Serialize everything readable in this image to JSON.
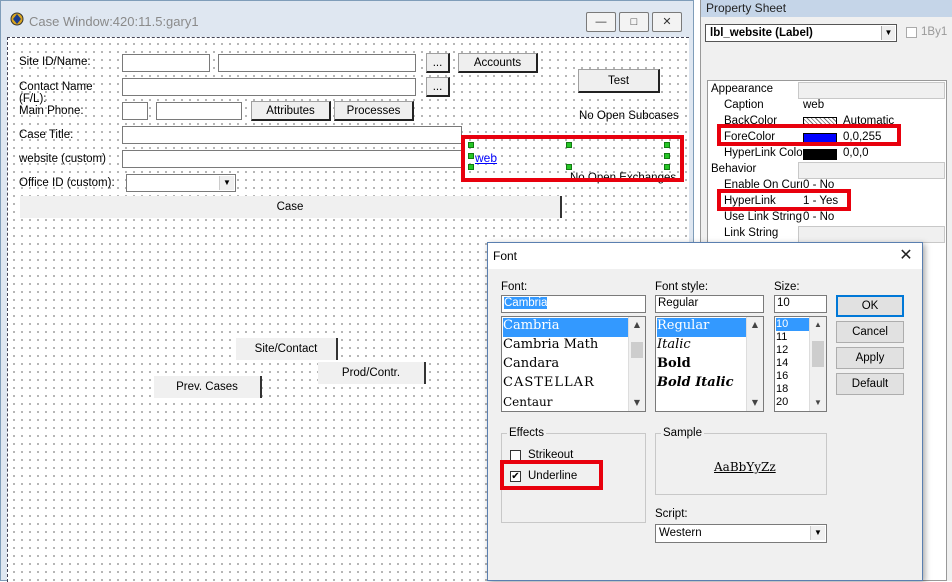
{
  "case_window": {
    "title": "Case Window:420:11.5:gary1",
    "controls": {
      "minimize": "—",
      "maximize": "□",
      "close": "✕"
    },
    "labels": {
      "site_id": "Site ID/Name:",
      "contact_name": "Contact Name",
      "contact_name_sub": "(F/L):",
      "main_phone": "Main Phone:",
      "case_title": "Case Title:",
      "website": "website (custom)",
      "office_id": "Office ID (custom):"
    },
    "buttons": {
      "ellipsis": "...",
      "accounts": "Accounts",
      "test": "Test",
      "attributes": "Attributes",
      "processes": "Processes",
      "case": "Case",
      "site_contact": "Site/Contact",
      "prod_contr": "Prod/Contr.",
      "prev_cases": "Prev. Cases"
    },
    "no_open_subcases": "No Open Subcases",
    "no_open_exchanges": "No Open Exchanges",
    "web_link": "web"
  },
  "property_sheet": {
    "title": "Property Sheet",
    "selected_object": "lbl_website  (Label)",
    "checkbox_label": "1By1",
    "categories": {
      "appearance": "Appearance",
      "behavior": "Behavior"
    },
    "properties": [
      {
        "name": "Caption",
        "value": "web"
      },
      {
        "name": "BackColor",
        "value": "Automatic"
      },
      {
        "name": "ForeColor",
        "value": "0,0,255"
      },
      {
        "name": "HyperLink Colo",
        "value": "0,0,0"
      },
      {
        "name": "Enable On Curr",
        "value": "0 - No"
      },
      {
        "name": "HyperLink",
        "value": "1 - Yes"
      },
      {
        "name": "Use Link String",
        "value": "0 - No"
      },
      {
        "name": "Link String",
        "value": ""
      }
    ],
    "colors": {
      "forecolor": "#0000ff",
      "hyperlink_color": "#000000"
    }
  },
  "font_dialog": {
    "title": "Font",
    "close": "✕",
    "font_label": "Font:",
    "font_value": "Cambria",
    "fonts": [
      "Cambria",
      "Cambria Math",
      "Candara",
      "CASTELLAR",
      "Centaur"
    ],
    "style_label": "Font style:",
    "style_value": "Regular",
    "styles": [
      "Regular",
      "Italic",
      "Bold",
      "Bold Italic"
    ],
    "size_label": "Size:",
    "size_value": "10",
    "sizes": [
      "10",
      "11",
      "12",
      "14",
      "16",
      "18",
      "20"
    ],
    "buttons": {
      "ok": "OK",
      "cancel": "Cancel",
      "apply": "Apply",
      "default": "Default"
    },
    "effects_label": "Effects",
    "strikeout_label": "Strikeout",
    "underline_label": "Underline",
    "underline_check": "✔",
    "sample_label": "Sample",
    "sample_text": "AaBbYyZz",
    "script_label": "Script:",
    "script_value": "Western"
  },
  "highlight_color": "#e8000d"
}
